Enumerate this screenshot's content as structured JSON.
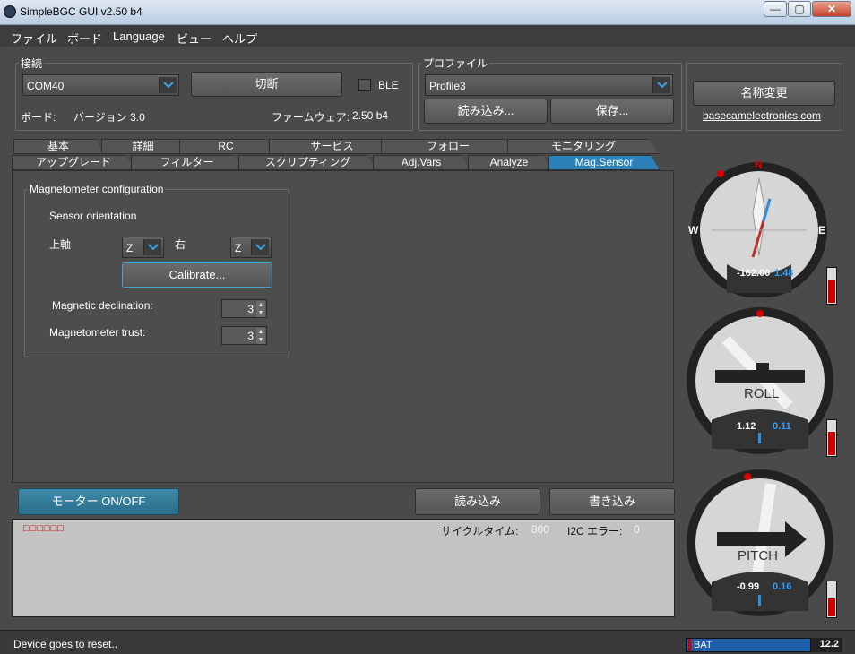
{
  "window": {
    "title": "SimpleBGC GUI v2.50 b4",
    "min": "—",
    "max": "▢",
    "close": "✕"
  },
  "menu": [
    "ファイル",
    "ボード",
    "Language",
    "ビュー",
    "ヘルプ"
  ],
  "connection": {
    "group_label": "接続",
    "port": "COM40",
    "disconnect_label": "切断",
    "ble_label": "BLE",
    "ble_checked": false,
    "board_label": "ボード:",
    "board_version": "バージョン 3.0",
    "firmware_label": "ファームウェア:",
    "firmware_version": "2.50 b4"
  },
  "profile": {
    "group_label": "プロファイル",
    "selected": "Profile3",
    "load_label": "読み込み...",
    "save_label": "保存...",
    "rename_label": "名称変更",
    "link": "basecamelectronics.com"
  },
  "tabs_row1": [
    "基本",
    "詳細",
    "RC",
    "サービス",
    "フォロー",
    "モニタリング"
  ],
  "tabs_row2": [
    "アップグレード",
    "フィルター",
    "スクリプティング",
    "Adj.Vars",
    "Analyze",
    "Mag.Sensor"
  ],
  "active_tab": "Mag.Sensor",
  "mag": {
    "group_label": "Magnetometer configuration",
    "orientation_label": "Sensor orientation",
    "top_axis_label": "上軸",
    "top_axis_value": "Z",
    "right_label": "右",
    "right_value": "Z",
    "calibrate_label": "Calibrate...",
    "declination_label": "Magnetic declination:",
    "declination_value": "3",
    "trust_label": "Magnetometer trust:",
    "trust_value": "3"
  },
  "bottom_buttons": {
    "motor": "モーター ON/OFF",
    "read": "読み込み",
    "write": "書き込み"
  },
  "console": {
    "indicators": "□□□□□□",
    "cycle_label": "サイクルタイム:",
    "cycle_value": "800",
    "i2c_label": "I2C エラー:",
    "i2c_value": "0"
  },
  "status": {
    "message": "Device goes to reset..",
    "bat_label": "BAT",
    "bat_value": "12.2"
  },
  "gauges": {
    "compass": {
      "n": "N",
      "w": "W",
      "e": "E",
      "value": "-162.00",
      "value2": "1.48"
    },
    "roll": {
      "label": "ROLL",
      "value": "1.12",
      "value2": "0.11"
    },
    "pitch": {
      "label": "PITCH",
      "value": "-0.99",
      "value2": "0.16"
    }
  },
  "colors": {
    "accent": "#2a82b8",
    "value_blue": "#2fa0ff",
    "indicator_red": "#cc0000"
  }
}
